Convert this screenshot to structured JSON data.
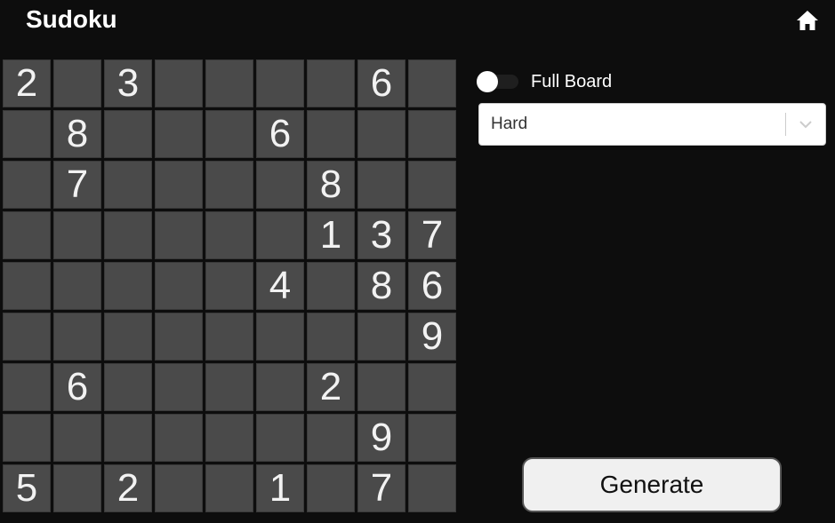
{
  "header": {
    "title": "Sudoku",
    "home_icon": "home-icon"
  },
  "board": {
    "cells": [
      [
        "2",
        "",
        "3",
        "",
        "",
        "",
        "",
        "6",
        ""
      ],
      [
        "",
        "8",
        "",
        "",
        "",
        "6",
        "",
        "",
        ""
      ],
      [
        "",
        "7",
        "",
        "",
        "",
        "",
        "8",
        "",
        ""
      ],
      [
        "",
        "",
        "",
        "",
        "",
        "",
        "1",
        "3",
        "7"
      ],
      [
        "",
        "",
        "",
        "",
        "",
        "4",
        "",
        "8",
        "6"
      ],
      [
        "",
        "",
        "",
        "",
        "",
        "",
        "",
        "",
        "9"
      ],
      [
        "",
        "6",
        "",
        "",
        "",
        "",
        "2",
        "",
        ""
      ],
      [
        "",
        "",
        "",
        "",
        "",
        "",
        "",
        "9",
        ""
      ],
      [
        "5",
        "",
        "2",
        "",
        "",
        "1",
        "",
        "7",
        ""
      ]
    ]
  },
  "controls": {
    "full_board_label": "Full Board",
    "full_board_on": false,
    "difficulty_selected": "Hard",
    "dropdown_icon": "chevron-down-icon",
    "generate_label": "Generate"
  },
  "colors": {
    "background": "#0d0d0d",
    "cell": "#4a4a4a",
    "text": "#ffffff"
  }
}
